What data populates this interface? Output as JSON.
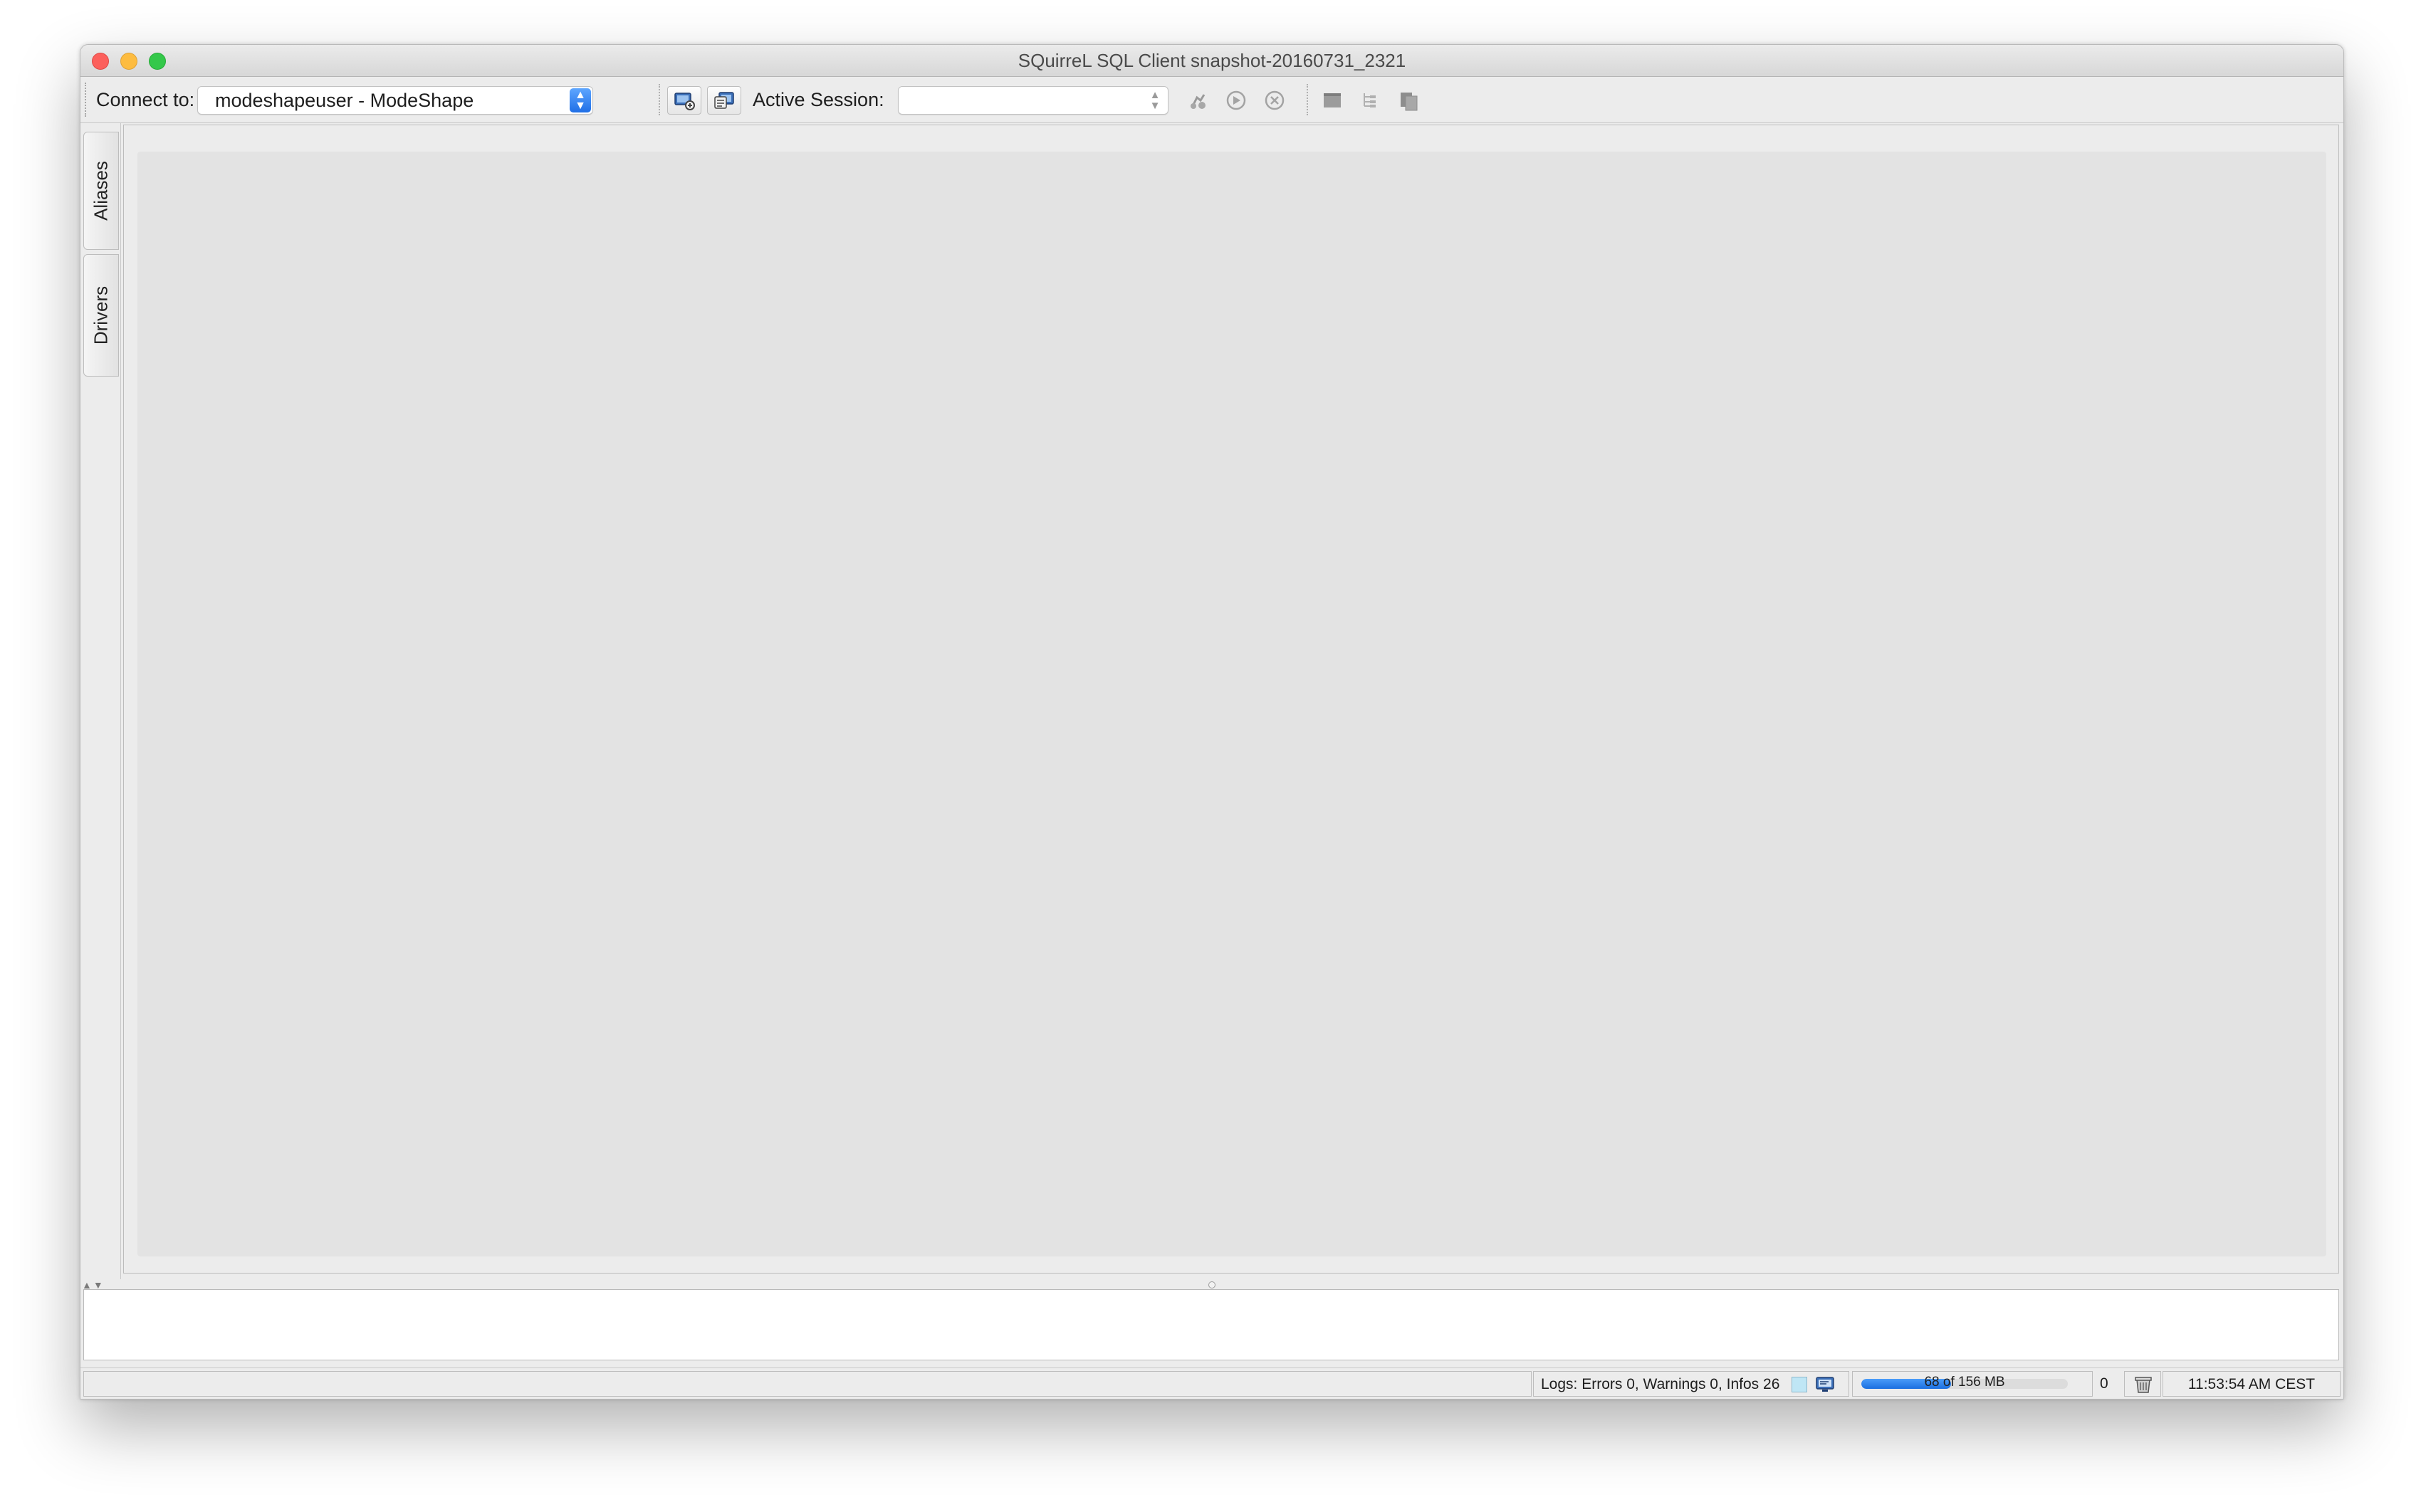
{
  "window": {
    "title": "SQuirreL SQL Client snapshot-20160731_2321"
  },
  "toolbar": {
    "connect_label": "Connect to:",
    "connect_value": "modeshapeuser - ModeShape",
    "session_label": "Active Session:",
    "session_value": ""
  },
  "side_tabs": [
    {
      "label": "Aliases"
    },
    {
      "label": "Drivers"
    }
  ],
  "statusbar": {
    "logs": "Logs: Errors 0, Warnings 0, Infos 26",
    "memory_label": "68 of 156 MB",
    "memory_used_fraction": 0.436,
    "counter": "0",
    "clock": "11:53:54 AM CEST"
  },
  "colors": {
    "accent": "#1f6fe6",
    "window_bg": "#ececec",
    "desktop_bg": "#e3e3e3"
  },
  "icons": [
    "new-session-icon",
    "connect-alias-icon",
    "session-properties-icon",
    "run-icon",
    "stop-icon",
    "window-icon",
    "tree-icon",
    "copy-icon",
    "garbage-collect-icon",
    "log-viewer-icon"
  ]
}
